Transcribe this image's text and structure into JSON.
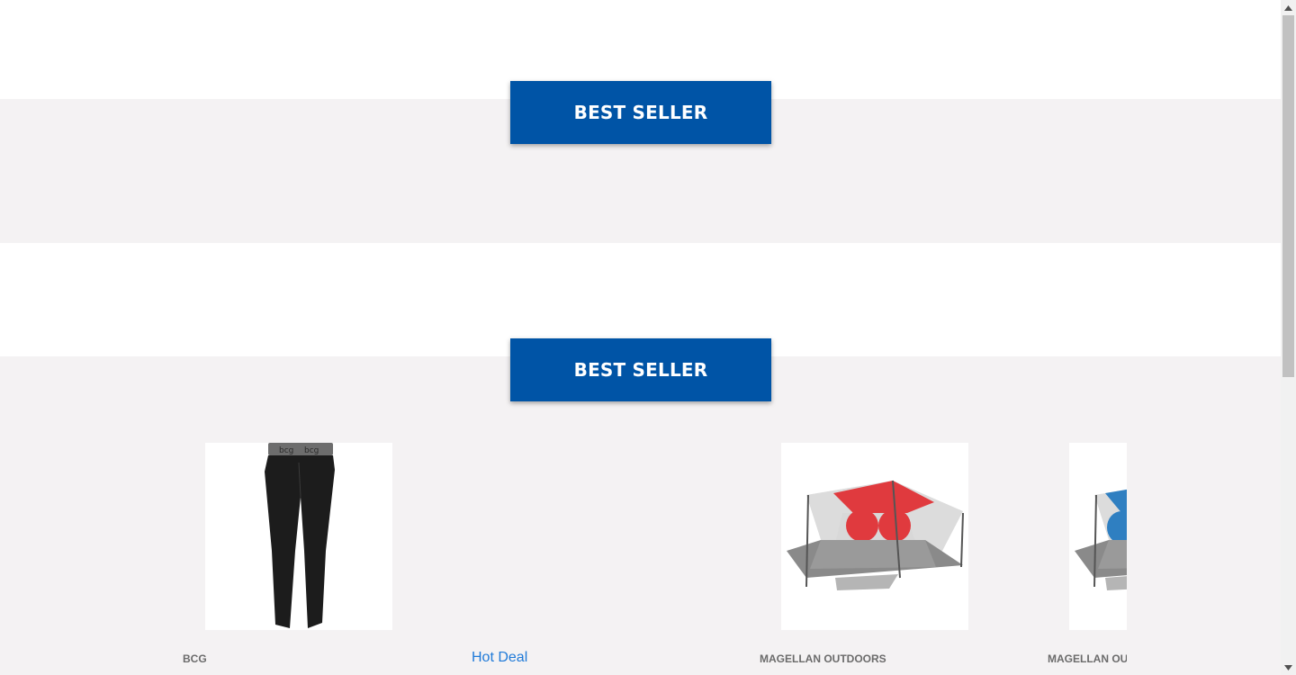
{
  "sections": [
    {
      "button_label": "BEST SELLER"
    },
    {
      "button_label": "BEST SELLER"
    }
  ],
  "products": [
    {
      "brand": "BCG",
      "image": "black-leggings",
      "badge": ""
    },
    {
      "brand": "",
      "image": "",
      "badge": "Hot Deal"
    },
    {
      "brand": "MAGELLAN OUTDOORS",
      "image": "red-gray-tent",
      "badge": ""
    },
    {
      "brand": "MAGELLAN OUTDOORS",
      "image": "blue-gray-tent",
      "badge": ""
    }
  ],
  "colors": {
    "accent": "#0054a6",
    "band_gray": "#f4f2f3",
    "hot_deal": "#1f7ad8",
    "brand_text": "#6b6b6b"
  },
  "scrollbar": {
    "up_icon": "arrow-up-icon",
    "down_icon": "arrow-down-icon"
  }
}
